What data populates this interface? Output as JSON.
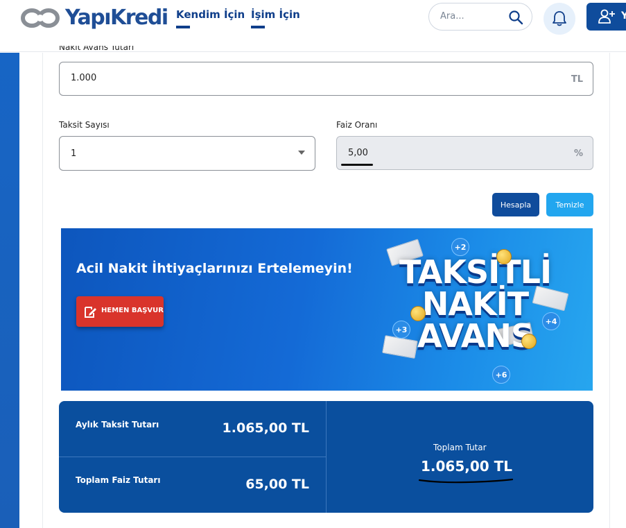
{
  "header": {
    "logo_text": "YapıKredi",
    "nav": [
      {
        "label": "Kendim İçin"
      },
      {
        "label": "İşim İçin"
      }
    ],
    "search_placeholder": "Ara...",
    "user_initial": "Y"
  },
  "form": {
    "amount_label_cut": "Nakit Avans Tutarı",
    "amount_value": "1.000",
    "amount_unit": "TL",
    "installment_label": "Taksit Sayısı",
    "installment_value": "1",
    "rate_label": "Faiz Oranı",
    "rate_value": "5,00",
    "rate_unit": "%",
    "calculate_label": "Hesapla",
    "clear_label": "Temizle"
  },
  "banner": {
    "title": "Acil Nakit İhtiyaçlarınızı Ertelemeyin!",
    "apply_label": "HEMEN BAŞVUR",
    "promo_line1": "TAKSİTLİ",
    "promo_line2": "NAKİT",
    "promo_line3": "AVANS",
    "bubble_1": "+2",
    "bubble_2": "+3",
    "bubble_3": "+4",
    "bubble_4": "+6"
  },
  "results": {
    "monthly_label": "Aylık Taksit Tutarı",
    "monthly_value": "1.065,00 TL",
    "interest_label": "Toplam Faiz Tutarı",
    "interest_value": "65,00 TL",
    "total_label": "Toplam Tutar",
    "total_value": "1.065,00 TL"
  },
  "colors": {
    "brand": "#0f4c9c",
    "accent": "#22a6ef",
    "apply": "#d9342b"
  }
}
